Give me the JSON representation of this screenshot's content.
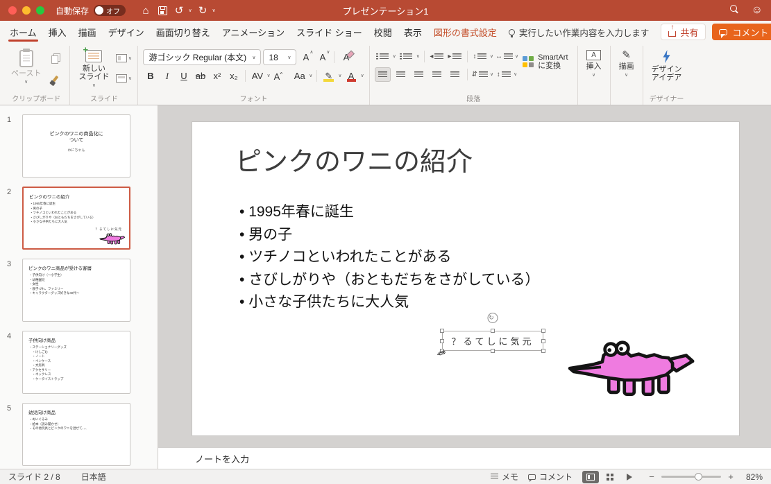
{
  "titlebar": {
    "autosave": "自動保存",
    "autosave_state": "オフ",
    "title": "プレゼンテーション1"
  },
  "tabs": {
    "home": "ホーム",
    "insert": "挿入",
    "draw": "描画",
    "design": "デザイン",
    "transitions": "画面切り替え",
    "animations": "アニメーション",
    "slideshow": "スライド ショー",
    "review": "校閲",
    "view": "表示",
    "shape_format": "図形の書式設定",
    "tell_me": "実行したい作業内容を入力します",
    "share": "共有",
    "comments": "コメント"
  },
  "ribbon": {
    "paste": "ペースト",
    "clipboard_group": "クリップボード",
    "new_slide": "新しい\nスライド",
    "slides_group": "スライド",
    "font_family": "游ゴシック Regular (本文)",
    "font_size": "18",
    "font_group": "フォント",
    "bold": "B",
    "italic": "I",
    "underline": "U",
    "strike": "ab",
    "superscript": "x²",
    "subscript": "x₂",
    "spacing": "AV",
    "phonetic": "A゛",
    "case": "Aa",
    "grow": "A",
    "shrink": "A",
    "clear": "A",
    "color": "A",
    "paragraph_group": "段落",
    "smartart": "SmartArt\nに変換",
    "insert": "挿入",
    "draw": "描画",
    "design_ideas": "デザイン\nアイデア",
    "designer_group": "デザイナー"
  },
  "panel": {
    "slides": [
      {
        "num": "1",
        "line1": "ピンクのワニの商品化に",
        "line2": "ついて",
        "subtitle": "わにちゃん"
      },
      {
        "num": "2",
        "title": "ピンクのワニの紹介",
        "lines": [
          "・1995年春に誕生",
          "・男の子",
          "・ツチノコといわれたことがある",
          "・さびしがりや（おともだちをさがしている）",
          "・小さな子供たちに大人気"
        ],
        "textbox": "？るてしに気元"
      },
      {
        "num": "3",
        "title": "ピンクのワニ商品が受ける客層",
        "lines": [
          "・子供向け（〜小学生）",
          "・幼稚園児",
          "・女性",
          "・親子づれ、ファミリー",
          "・キャラクターグッズ好きな40代〜"
        ]
      },
      {
        "num": "4",
        "title": "子供向け商品",
        "lines": [
          "・ステーショナリーグッズ",
          "　・けしごむ",
          "　・ノート",
          "　・ペンケース",
          "　・文房具",
          "・アクセサリー",
          "　・ネックレス",
          "　・ケータイストラップ"
        ]
      },
      {
        "num": "5",
        "title": "幼児向け商品",
        "lines": [
          "・ぬいぐるみ",
          "・絵本（読み聞かせ）",
          "・その他玩具とピンクのワニを混ぜて、、、"
        ]
      }
    ]
  },
  "slide": {
    "title": "ピンクのワニの紹介",
    "bullets": [
      "1995年春に誕生",
      "男の子",
      "ツチノコといわれたことがある",
      "さびしがりや（おともだちをさがしている）",
      "小さな子供たちに大人気"
    ],
    "textbox": "？るてしに気元"
  },
  "notes": {
    "placeholder": "ノートを入力"
  },
  "status": {
    "slide_pos": "スライド 2 / 8",
    "language": "日本語",
    "memo": "メモ",
    "comments": "コメント",
    "zoom": "82%"
  },
  "colors": {
    "titlebar": "#B84A33",
    "accent_red": "#C0402B",
    "comment_orange": "#E8641C",
    "selection_border": "#cd5b44",
    "croc_pink": "#EF7BE0"
  }
}
